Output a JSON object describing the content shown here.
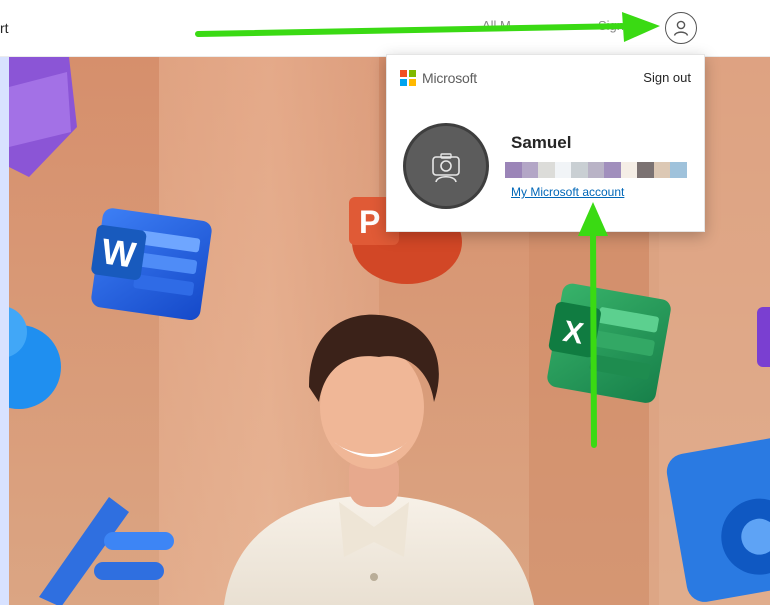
{
  "topbar": {
    "left_text": "rt",
    "ghost_left": "All M",
    "ghost_right": "Sign in",
    "profile_icon": "person-circle-icon"
  },
  "account_popup": {
    "brand": "Microsoft",
    "sign_out": "Sign out",
    "user_name": "Samuel",
    "account_link": "My Microsoft account",
    "avatar_icon": "camera-person-icon",
    "email_redaction_colors": [
      "#9b85b8",
      "#b3a6c6",
      "#dcdcd9",
      "#f1f4f7",
      "#c9cfd3",
      "#b9b3c6",
      "#a18fbd",
      "#f5eee6",
      "#7b7272",
      "#dcc8b4",
      "#9fc2db"
    ]
  },
  "ms_logo_colors": [
    "#f25022",
    "#7fba00",
    "#00a4ef",
    "#ffb900"
  ],
  "annotation_color": "#33dd11",
  "hero": {
    "app_icons": [
      "word-icon",
      "powerpoint-icon",
      "excel-icon",
      "onedrive-icon",
      "editor-icon",
      "outlook-icon",
      "onenote-icon"
    ]
  }
}
